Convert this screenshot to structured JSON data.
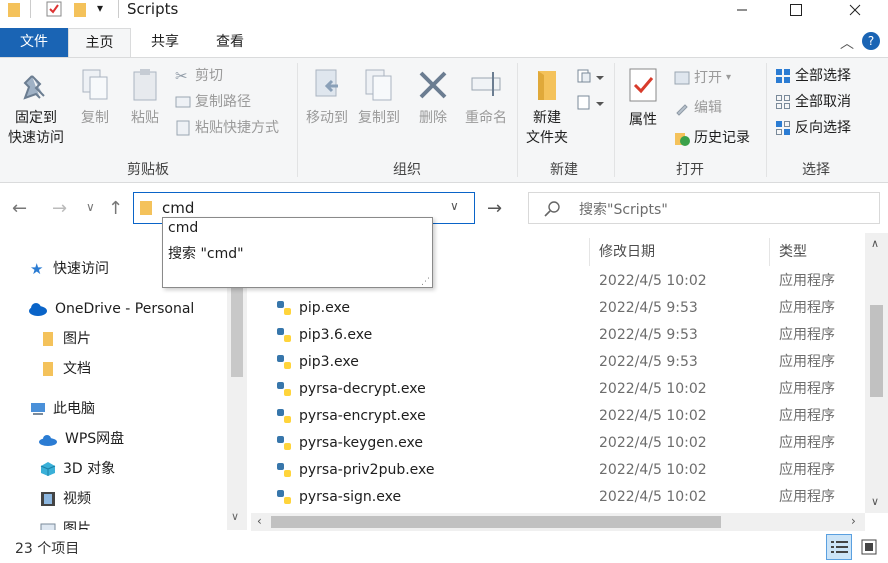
{
  "window": {
    "title": "Scripts"
  },
  "tabs": [
    {
      "label": "文件"
    },
    {
      "label": "主页"
    },
    {
      "label": "共享"
    },
    {
      "label": "查看"
    }
  ],
  "ribbon": {
    "clipboard": {
      "label": "剪贴板",
      "pin": "固定到\n快速访问",
      "pin_line1": "固定到",
      "pin_line2": "快速访问",
      "copy": "复制",
      "paste": "粘贴",
      "cut": "剪切",
      "copy_path": "复制路径",
      "paste_shortcut": "粘贴快捷方式"
    },
    "organize": {
      "label": "组织",
      "move_to": "移动到",
      "copy_to": "复制到",
      "delete": "删除",
      "rename": "重命名"
    },
    "new": {
      "label": "新建",
      "new_folder_line1": "新建",
      "new_folder_line2": "文件夹"
    },
    "open": {
      "label": "打开",
      "properties": "属性",
      "open": "打开",
      "edit": "编辑",
      "history": "历史记录"
    },
    "select": {
      "label": "选择",
      "select_all": "全部选择",
      "select_none": "全部取消",
      "invert": "反向选择"
    }
  },
  "address": {
    "value": "cmd"
  },
  "search": {
    "placeholder": "搜索\"Scripts\""
  },
  "suggestions": [
    {
      "label": "cmd"
    },
    {
      "label": "搜索 \"cmd\""
    }
  ],
  "navpane": {
    "items": [
      {
        "label": "快速访问"
      },
      {
        "label": "OneDrive - Personal"
      },
      {
        "label": "图片"
      },
      {
        "label": "文档"
      },
      {
        "label": "此电脑"
      },
      {
        "label": "WPS网盘"
      },
      {
        "label": "3D 对象"
      },
      {
        "label": "视频"
      },
      {
        "label": "图片"
      }
    ]
  },
  "filelist": {
    "columns": {
      "date": "修改日期",
      "type": "类型"
    },
    "rows": [
      {
        "name": "",
        "date": "2022/4/5 10:02",
        "type": "应用程序"
      },
      {
        "name": "pip.exe",
        "date": "2022/4/5 9:53",
        "type": "应用程序"
      },
      {
        "name": "pip3.6.exe",
        "date": "2022/4/5 9:53",
        "type": "应用程序"
      },
      {
        "name": "pip3.exe",
        "date": "2022/4/5 9:53",
        "type": "应用程序"
      },
      {
        "name": "pyrsa-decrypt.exe",
        "date": "2022/4/5 10:02",
        "type": "应用程序"
      },
      {
        "name": "pyrsa-encrypt.exe",
        "date": "2022/4/5 10:02",
        "type": "应用程序"
      },
      {
        "name": "pyrsa-keygen.exe",
        "date": "2022/4/5 10:02",
        "type": "应用程序"
      },
      {
        "name": "pyrsa-priv2pub.exe",
        "date": "2022/4/5 10:02",
        "type": "应用程序"
      },
      {
        "name": "pyrsa-sign.exe",
        "date": "2022/4/5 10:02",
        "type": "应用程序"
      }
    ]
  },
  "status": {
    "count": "23 个项目"
  },
  "colors": {
    "accent": "#1a64b4",
    "folder": "#f4c25b"
  }
}
